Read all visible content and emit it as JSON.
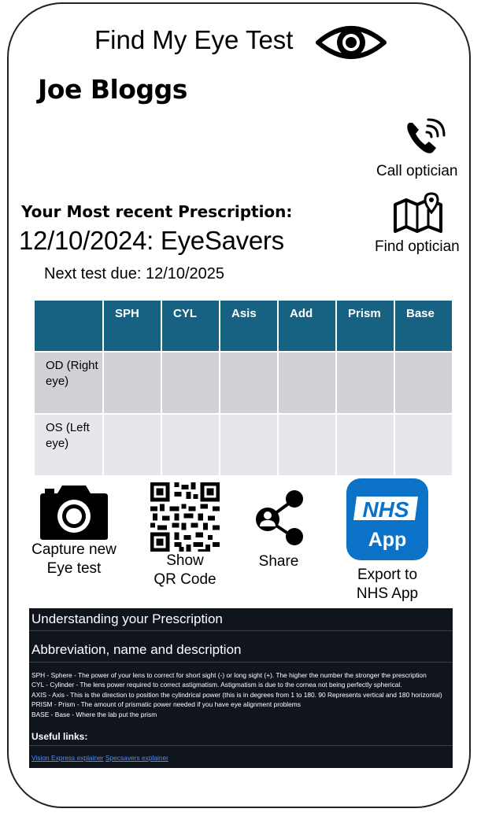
{
  "header": {
    "app_title": "Find My Eye Test",
    "app_icon": "eye-icon",
    "user_name": "Joe Bloggs"
  },
  "quick_actions": {
    "call_label": "Call optician",
    "call_icon": "phone-icon",
    "find_label": "Find optician",
    "find_icon": "map-pin-icon"
  },
  "prescription": {
    "heading": "Your Most recent Prescription:",
    "summary": "12/10/2024: EyeSavers",
    "next_test": "Next test due: 12/10/2025",
    "columns": [
      "",
      "SPH",
      "CYL",
      "Asis",
      "Add",
      "Prism",
      "Base"
    ],
    "rows": [
      {
        "label": "OD (Right eye)",
        "values": [
          "",
          "",
          "",
          "",
          "",
          ""
        ]
      },
      {
        "label": "OS (Left eye)",
        "values": [
          "",
          "",
          "",
          "",
          "",
          ""
        ]
      }
    ]
  },
  "actions": [
    {
      "label": "Capture new\nEye test",
      "icon": "camera-icon"
    },
    {
      "label": "Show\nQR Code",
      "icon": "qr-code-icon"
    },
    {
      "label": "Share",
      "icon": "share-icon"
    },
    {
      "label": "Export to\nNHS App",
      "icon": "nhs-app-icon",
      "icon_text_top": "NHS",
      "icon_text_bottom": "App"
    }
  ],
  "colors": {
    "table_header": "#176283",
    "nhs_blue": "#0b72c8",
    "panel_bg": "#10141c"
  },
  "explainer": {
    "title": "Understanding your Prescription",
    "subtitle": "Abbreviation, name and description",
    "definitions": [
      "SPH - Sphere - The power of your lens to correct for short sight (-) or long sight (+). The higher the number the stronger the prescription",
      "CYL - Cylinder - The lens power required to correct astigmatism. Astigmatism is due to the cornea not being perfectly spherical.",
      "AXIS - Axis - This is the direction to position the cylindrical power (this is in degrees from 1 to 180. 90 Represents vertical and 180 horizontal)",
      "PRISM - Prism - The amount of prismatic power needed if you have eye alignment problems",
      "BASE - Base - Where the lab put the prism"
    ],
    "links_heading": "Useful links:",
    "links": [
      "Vision Express explainer",
      "Specsavers explainer"
    ]
  }
}
